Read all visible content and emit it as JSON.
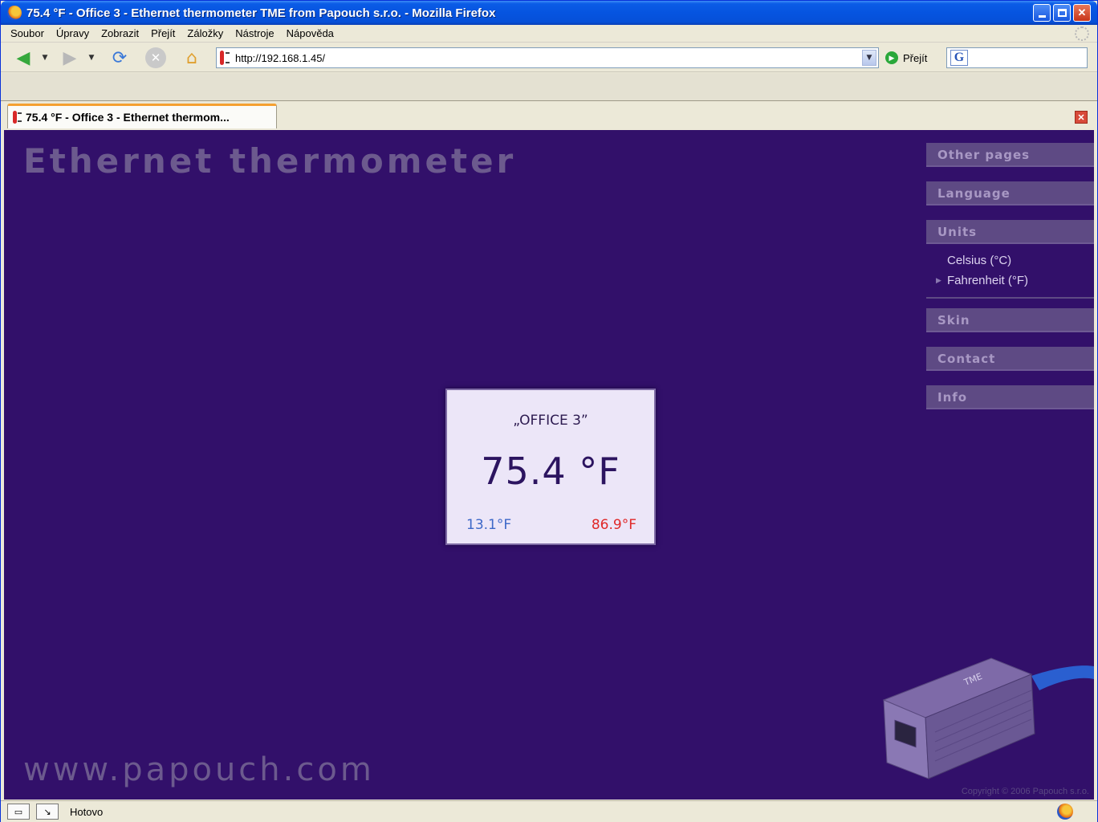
{
  "window": {
    "title": "75.4 °F - Office 3 - Ethernet thermometer TME from Papouch s.r.o. - Mozilla Firefox"
  },
  "menu": [
    "Soubor",
    "Úpravy",
    "Zobrazit",
    "Přejít",
    "Záložky",
    "Nástroje",
    "Nápověda"
  ],
  "navbar": {
    "url": "http://192.168.1.45/",
    "go_label": "Přejít",
    "search_engine_icon": "G"
  },
  "tab": {
    "label": "75.4 °F - Office 3 - Ethernet thermom..."
  },
  "page": {
    "title": "Ethernet thermometer",
    "footer": "www.papouch.com",
    "copyright": "Copyright © 2006 Papouch s.r.o."
  },
  "sidebar": {
    "other_pages": "Other pages",
    "language": "Language",
    "units": "Units",
    "units_options": [
      "Celsius (°C)",
      "Fahrenheit (°F)"
    ],
    "units_selected": "Fahrenheit (°F)",
    "skin": "Skin",
    "contact": "Contact",
    "info": "Info"
  },
  "reading": {
    "name": "„OFFICE 3”",
    "temperature": "75.4 °F",
    "min": "13.1°F",
    "max": "86.9°F",
    "min_color": "#3d68c8",
    "max_color": "#e02828"
  },
  "statusbar": {
    "text": "Hotovo"
  },
  "colors": {
    "page_bg": "#32106a",
    "heading": "#6c5a8e",
    "sidebar_header": "#5e4a84"
  }
}
